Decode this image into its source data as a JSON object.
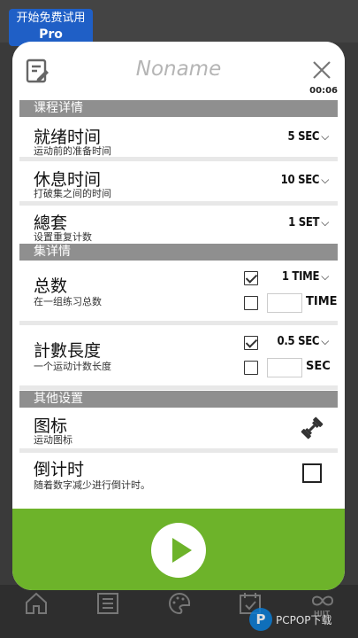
{
  "background": {
    "trial_line1": "开始免费试用",
    "trial_line2": "Pro"
  },
  "dialog": {
    "title": "Noname",
    "timer": "00:06"
  },
  "sections": {
    "course_details": "课程详情",
    "set_details": "集详情",
    "other_settings": "其他设置"
  },
  "rows": {
    "ready": {
      "label": "就绪时间",
      "sub": "运动前的准备时间",
      "value": "5 SEC"
    },
    "rest": {
      "label": "休息时间",
      "sub": "打破集之间的时间",
      "value": "10 SEC"
    },
    "sets": {
      "label": "總套",
      "sub": "设置重复计数",
      "value": "1 SET"
    },
    "total": {
      "label": "总数",
      "sub": "在一组练习总数",
      "value": "1 TIME",
      "unit": "TIME",
      "checked_top": true,
      "checked_bottom": false
    },
    "count_len": {
      "label": "計數長度",
      "sub": "一个运动计数长度",
      "value": "0.5 SEC",
      "unit": "SEC",
      "checked_top": true,
      "checked_bottom": false
    },
    "icon": {
      "label": "图标",
      "sub": "运动图标",
      "icon": "dumbbell-icon"
    },
    "countdown": {
      "label": "倒计时",
      "sub": "随着数字减少进行倒计时。",
      "checked": false
    }
  },
  "bottom_nav": {
    "items": [
      "home-icon",
      "list-icon",
      "palette-icon",
      "calendar-check-icon",
      "hiit-icon"
    ],
    "hiit_label": "HIIT"
  },
  "watermark": {
    "text": "PCPOP下载"
  },
  "colors": {
    "accent_green": "#6db32a",
    "section_gray": "#8f8f8f",
    "trial_blue": "#1f5fc6"
  }
}
